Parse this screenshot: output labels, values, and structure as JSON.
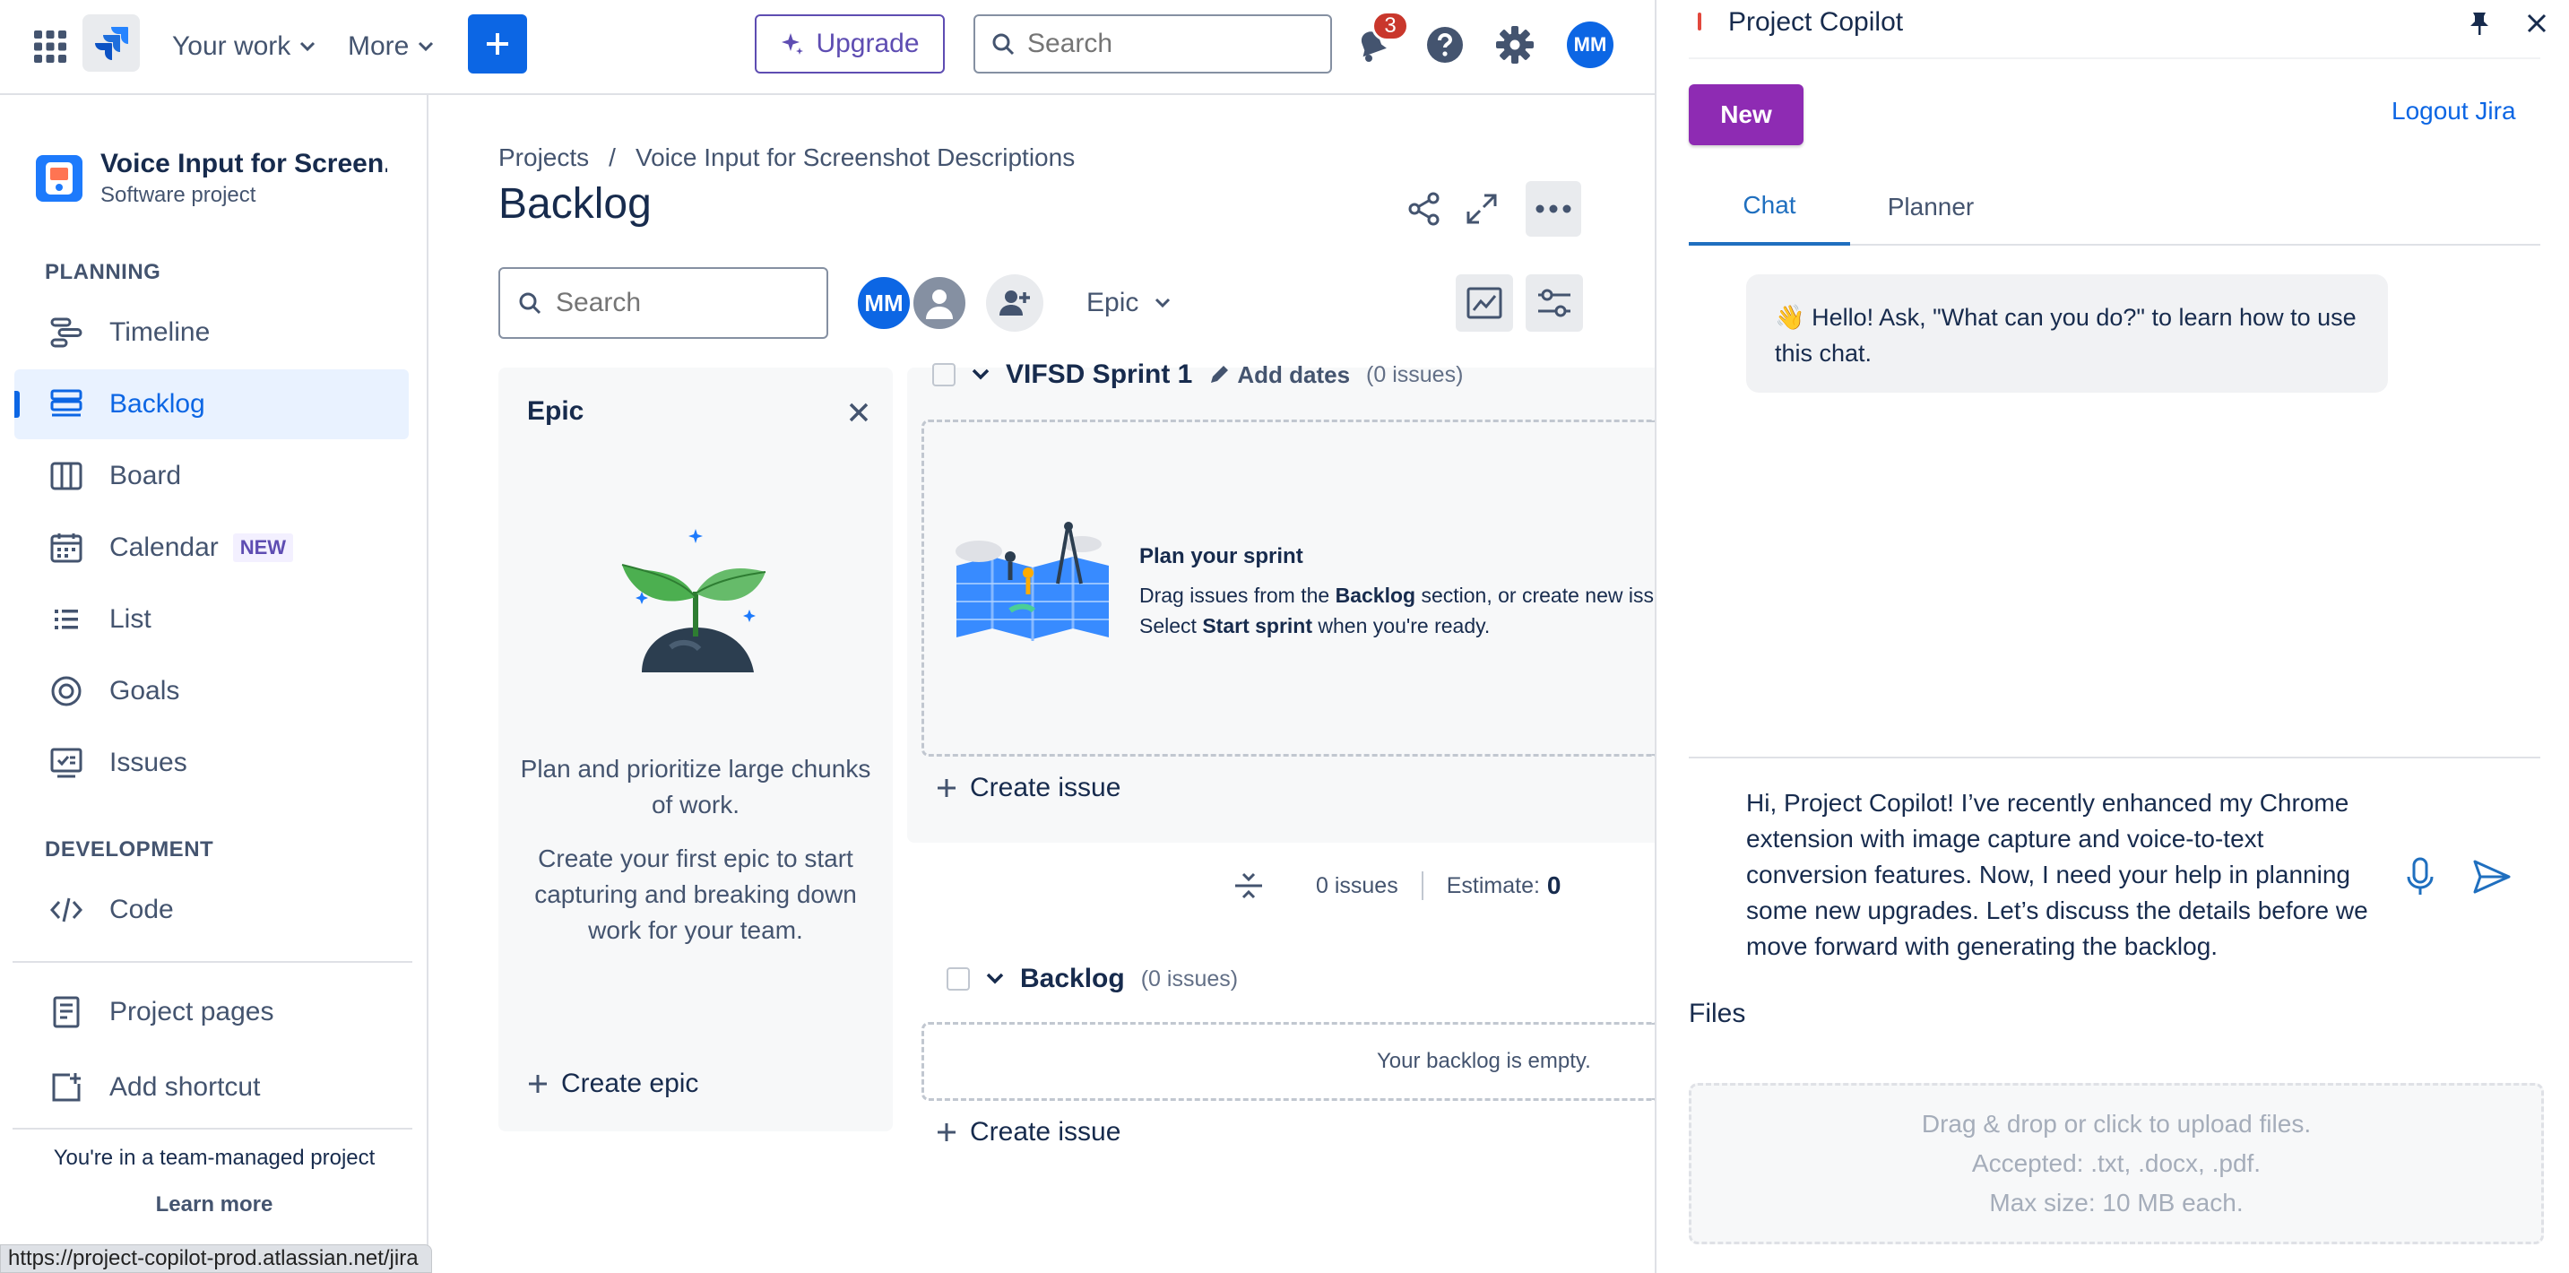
{
  "topnav": {
    "your_work": "Your work",
    "more": "More",
    "upgrade": "Upgrade",
    "search_placeholder": "Search",
    "notifications_count": "3",
    "avatar_initials": "MM"
  },
  "sidebar": {
    "project_name": "Voice Input for Screen...",
    "project_type": "Software project",
    "planning_title": "PLANNING",
    "development_title": "DEVELOPMENT",
    "items": [
      {
        "label": "Timeline"
      },
      {
        "label": "Backlog",
        "active": true
      },
      {
        "label": "Board"
      },
      {
        "label": "Calendar",
        "badge": "NEW"
      },
      {
        "label": "List"
      },
      {
        "label": "Goals"
      },
      {
        "label": "Issues"
      }
    ],
    "dev_items": [
      {
        "label": "Code"
      }
    ],
    "bottom_items": [
      {
        "label": "Project pages"
      },
      {
        "label": "Add shortcut"
      }
    ],
    "footer_text": "You're in a team-managed project",
    "footer_link": "Learn more"
  },
  "status_url": "https://project-copilot-prod.atlassian.net/jira",
  "main": {
    "breadcrumb": [
      "Projects",
      "/",
      "Voice Input for Screenshot Descriptions"
    ],
    "title": "Backlog",
    "search_placeholder": "Search",
    "avatar_initials": "MM",
    "epic_filter": "Epic"
  },
  "epic_panel": {
    "title": "Epic",
    "text1": "Plan and prioritize large chunks of work.",
    "text2": "Create your first epic to start capturing and breaking down work for your team.",
    "create_label": "Create epic"
  },
  "sprint": {
    "name": "VIFSD Sprint 1",
    "add_dates": "Add dates",
    "count": "(0 issues)",
    "plan_title": "Plan your sprint",
    "plan_line1_a": "Drag issues from the ",
    "plan_line1_b": "Backlog",
    "plan_line1_c": " section, or create new issues",
    "plan_line2_a": "Select ",
    "plan_line2_b": "Start sprint",
    "plan_line2_c": " when you're ready.",
    "create_issue": "Create issue",
    "issues_count": "0 issues",
    "estimate_label": "Estimate:",
    "estimate_value": "0"
  },
  "backlog": {
    "name": "Backlog",
    "count": "(0 issues)",
    "empty": "Your backlog is empty.",
    "create_issue": "Create issue"
  },
  "copilot": {
    "title": "Project Copilot",
    "new_label": "New",
    "logout_label": "Logout Jira",
    "tabs": [
      {
        "label": "Chat",
        "active": true
      },
      {
        "label": "Planner"
      }
    ],
    "greeting": "👋 Hello! Ask, \"What can you do?\" to learn how to use this chat.",
    "input_text": "Hi, Project Copilot! I’ve recently enhanced my Chrome extension with image capture and voice-to-text conversion features. Now, I need your help in planning some new upgrades. Let’s discuss the details before we move forward with generating the backlog.",
    "files_title": "Files",
    "drop_line1": "Drag & drop or click to upload files.",
    "drop_line2": "Accepted: .txt, .docx, .pdf.",
    "drop_line3": "Max size: 10 MB each."
  }
}
